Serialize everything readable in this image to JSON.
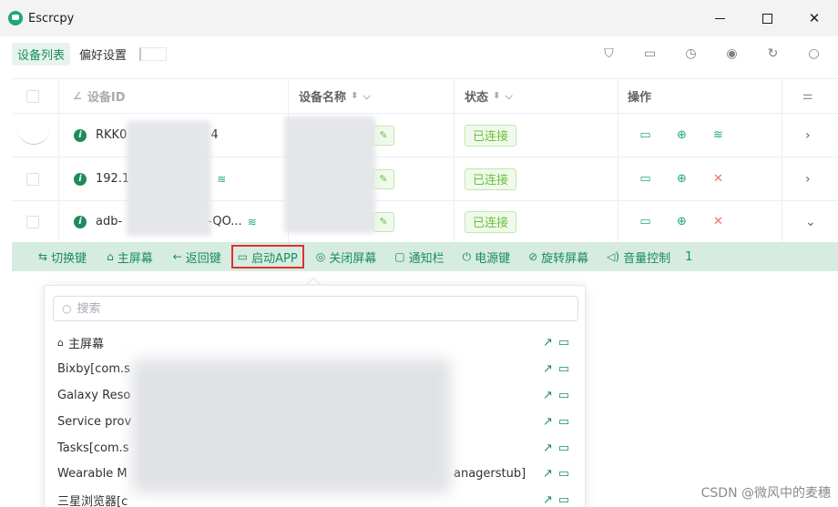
{
  "window": {
    "title": "Escrcpy",
    "minimize_glyph": "—",
    "close_glyph": "✕"
  },
  "toolbar": {
    "tabs": [
      {
        "label": "设备列表",
        "active": true
      },
      {
        "label": "偏好设置",
        "active": false
      }
    ],
    "icons": [
      "device-mirror-icon",
      "screen-cast-icon",
      "history-icon",
      "eye-icon",
      "refresh-icon",
      "search-icon"
    ]
  },
  "table": {
    "headers": {
      "id": "设备ID",
      "name": "设备名称",
      "status": "状态",
      "actions": "操作"
    },
    "rows": [
      {
        "id_visible": "RKK0",
        "id_suffix": "4",
        "status": "已连接",
        "wifi": false,
        "ops": [
          "mirror",
          "add",
          "wifi"
        ],
        "expanded": false
      },
      {
        "id_visible": "192.1",
        "id_suffix": "",
        "status": "已连接",
        "wifi": true,
        "ops": [
          "mirror",
          "add",
          "close"
        ],
        "expanded": false
      },
      {
        "id_visible": "adb-",
        "id_suffix": "-QO...",
        "status": "已连接",
        "wifi": true,
        "ops": [
          "mirror",
          "add",
          "close"
        ],
        "expanded": true
      }
    ]
  },
  "controls": [
    {
      "label": "切换键",
      "icon": "⇆"
    },
    {
      "label": "主屏幕",
      "icon": "⌂"
    },
    {
      "label": "返回键",
      "icon": "←"
    },
    {
      "label": "启动APP",
      "icon": "▭",
      "highlighted": true
    },
    {
      "label": "关闭屏幕",
      "icon": "◎"
    },
    {
      "label": "通知栏",
      "icon": "▢"
    },
    {
      "label": "电源键",
      "icon": "⏻"
    },
    {
      "label": "旋转屏幕",
      "icon": "⊘"
    },
    {
      "label": "音量控制",
      "icon": "◁)"
    },
    {
      "label": "1",
      "icon": ""
    }
  ],
  "popover": {
    "search_placeholder": "搜索",
    "apps": [
      {
        "label": "主屏幕",
        "home": true,
        "tail": ""
      },
      {
        "label": "Bixby[com.s",
        "tail": ""
      },
      {
        "label": "Galaxy Reso",
        "tail": ""
      },
      {
        "label": "Service prov",
        "tail": ""
      },
      {
        "label": "Tasks[com.s",
        "tail": ""
      },
      {
        "label": "Wearable M",
        "tail": "anagerstub]"
      },
      {
        "label": "三星浏览器[c",
        "tail": ""
      }
    ]
  },
  "watermark": "CSDN @微风中的麦穗",
  "colors": {
    "accent": "#1a8c5f",
    "success": "#67c23a",
    "danger": "#f56c6c",
    "highlight_border": "#e03030"
  }
}
